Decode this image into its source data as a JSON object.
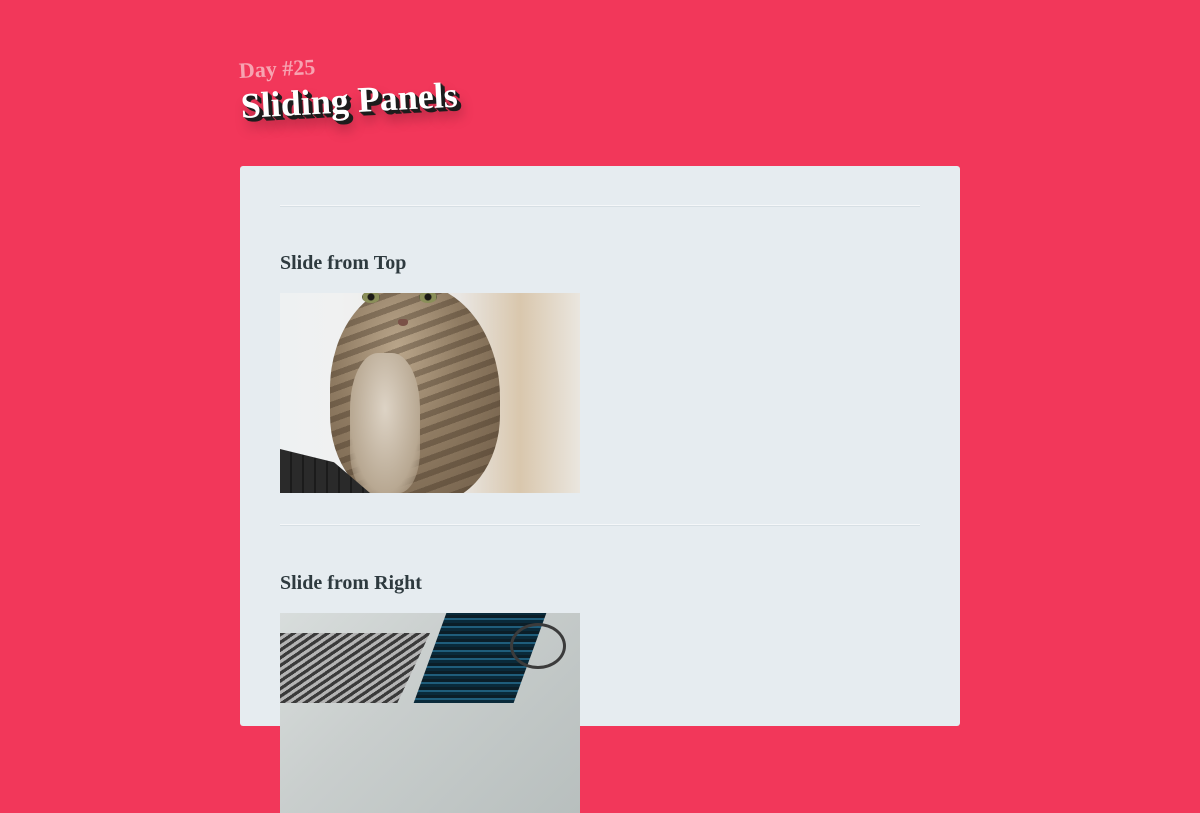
{
  "header": {
    "day": "Day #25",
    "title": "Sliding Panels"
  },
  "sections": [
    {
      "heading": "Slide from Top",
      "image_icon": "cat-photo"
    },
    {
      "heading": "Slide from Right",
      "image_icon": "laptop-photo"
    }
  ],
  "colors": {
    "page_background": "#f2375a",
    "panel_background": "#e6ecf0",
    "heading_text": "#2e3a3f",
    "day_text": "#f7a3b1",
    "title_text": "#ffffff"
  }
}
